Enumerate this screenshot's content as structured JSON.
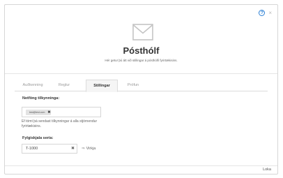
{
  "header": {
    "title": "Pósthólf",
    "subtitle": "Hér getur þú átt við stillingar á pósthólfi fyrirtækisins.",
    "icon": "mail-icon",
    "help_icon": "?",
    "close_icon": "×"
  },
  "tabs": [
    {
      "label": "Auðkenning",
      "active": false
    },
    {
      "label": "Reglur",
      "active": false
    },
    {
      "label": "Stillingar",
      "active": true
    },
    {
      "label": "Prófun",
      "active": false
    }
  ],
  "settings": {
    "notification_emails_label": "Netföng tilkynninga:",
    "chips": [
      {
        "text": "test@test.com"
      }
    ],
    "help_text": "Ef tómt þá sendast tilkynningar á alla stjórnendur fyrirtækisins.",
    "series_label": "Fylgiskjala sería:",
    "series_value": "T-1000",
    "apply_label": "Virkja"
  },
  "footer": {
    "close_label": "Loka"
  },
  "colors": {
    "accent": "#2a7fd4",
    "border": "#d6d6d6",
    "tab_active_bg": "#f5f5f5"
  }
}
